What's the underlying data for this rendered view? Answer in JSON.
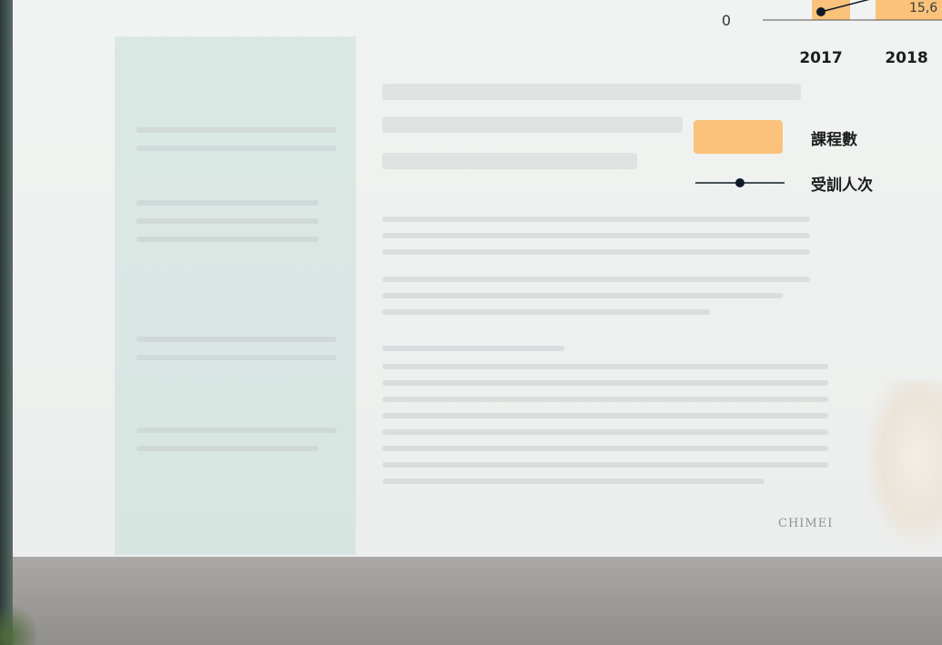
{
  "background": {
    "logo_text": "CHIMEI"
  },
  "chart_data": {
    "type": "bar",
    "categories": [
      "2017",
      "2018"
    ],
    "series": [
      {
        "name": "課程數",
        "kind": "bar",
        "color": "#fac27a",
        "values": [
          null,
          null
        ]
      },
      {
        "name": "受訓人次",
        "kind": "line",
        "color": "#0f1a26",
        "values": [
          null,
          null
        ]
      }
    ],
    "y_tick_labels": [
      "0"
    ],
    "data_labels": [
      "15,6"
    ],
    "legend_position": "right",
    "grid": false
  }
}
